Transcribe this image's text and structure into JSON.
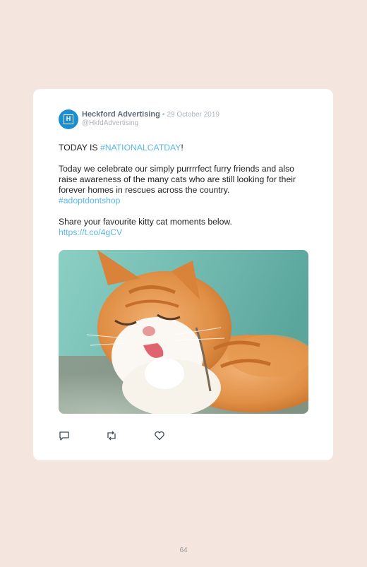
{
  "tweet": {
    "avatar_letter": "H",
    "author_name": "Heckford Advertising",
    "separator": "•",
    "date": "29 October 2019",
    "handle": "@HkfdAdvertising",
    "line1_prefix": "TODAY IS ",
    "line1_hashtag": "#NATIONALCATDAY",
    "line1_suffix": "!",
    "paragraph2": "Today we celebrate our simply purrrrfect furry friends and also raise awareness of the many cats who are still looking for their forever homes in rescues across the country.",
    "paragraph2_hashtag": "#adoptdontshop",
    "paragraph3": "Share your favourite kitty cat moments below.",
    "link": "https://t.co/4gCV",
    "actions": [
      "reply-icon",
      "retweet-icon",
      "like-icon"
    ]
  },
  "page_number": "64",
  "colors": {
    "background": "#f4e6df",
    "card": "#ffffff",
    "accent": "#5ab8ea",
    "avatar": "#1a8fd0"
  }
}
